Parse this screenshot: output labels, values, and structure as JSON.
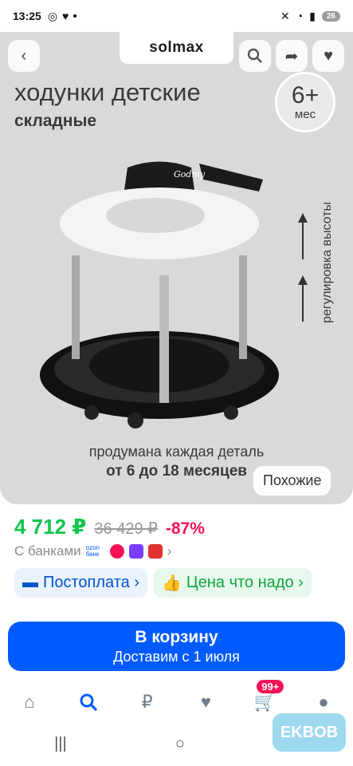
{
  "status_bar": {
    "time": "13:25",
    "battery": "26"
  },
  "gallery": {
    "brand": "solmax",
    "headline": "ходунки детские",
    "subline": "складные",
    "age_number": "6+",
    "age_unit": "мес",
    "height_label": "регулировка высоты",
    "caption_line1": "продумана каждая деталь",
    "caption_line2": "от 6 до 18 месяцев",
    "similar_label": "Похожие",
    "product_logo": "Godmy"
  },
  "price": {
    "current": "4 712 ₽",
    "old": "36 429 ₽",
    "discount": "-87%"
  },
  "banks": {
    "label": "С банками",
    "ozon_text": "ozon банк",
    "chevron": "›"
  },
  "chips": [
    {
      "label": "Постоплата ›"
    },
    {
      "label": "Цена что надо ›"
    }
  ],
  "cart": {
    "title": "В корзину",
    "subtitle": "Доставим с 1 июля"
  },
  "tabbar": {
    "cart_badge": "99+"
  },
  "watermark": "EKBOB",
  "colors": {
    "accent": "#005bff",
    "price": "#10c44c",
    "discount": "#f91155"
  }
}
